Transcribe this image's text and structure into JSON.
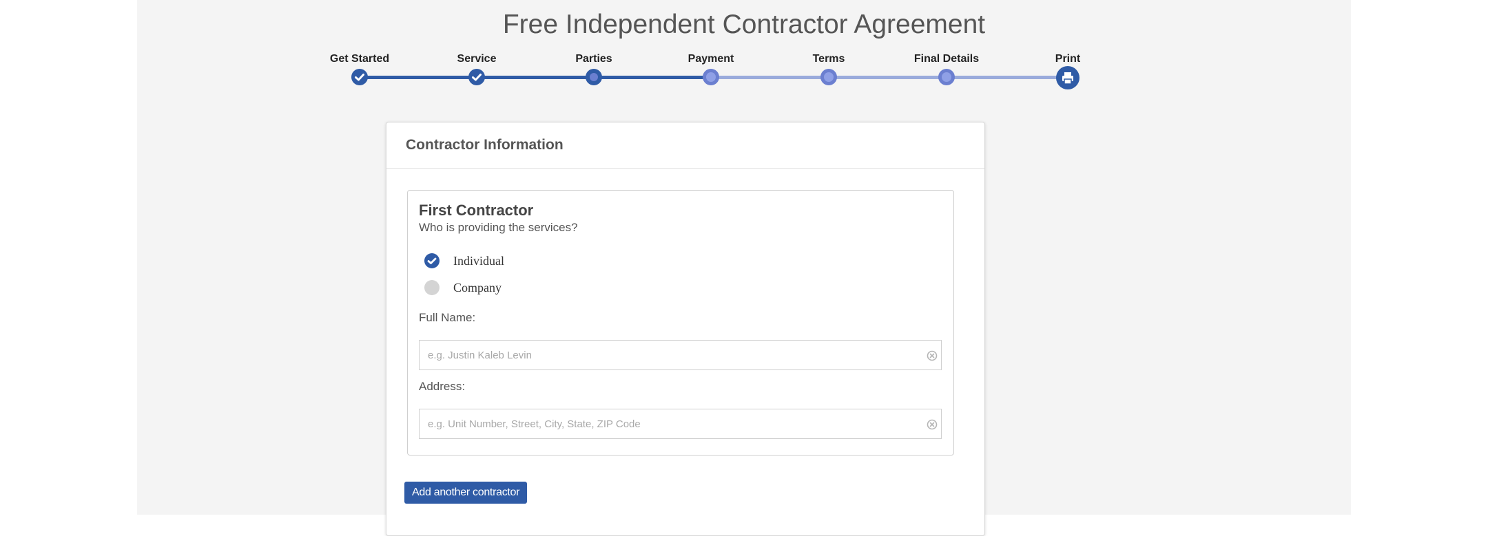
{
  "page": {
    "title": "Free Independent Contractor Agreement"
  },
  "stepper": {
    "steps": [
      {
        "label": "Get Started",
        "state": "done",
        "icon": "check-icon"
      },
      {
        "label": "Service",
        "state": "done",
        "icon": "check-icon"
      },
      {
        "label": "Parties",
        "state": "current",
        "icon": "dot-icon"
      },
      {
        "label": "Payment",
        "state": "todo",
        "icon": "dot-icon"
      },
      {
        "label": "Terms",
        "state": "todo",
        "icon": "dot-icon"
      },
      {
        "label": "Final Details",
        "state": "todo",
        "icon": "dot-icon"
      },
      {
        "label": "Print",
        "state": "todo",
        "icon": "printer-icon"
      }
    ]
  },
  "card": {
    "title": "Contractor Information",
    "section": {
      "title": "First Contractor",
      "subtitle": "Who is providing the services?",
      "options": [
        {
          "label": "Individual",
          "checked": true
        },
        {
          "label": "Company",
          "checked": false
        }
      ],
      "full_name": {
        "label": "Full Name:",
        "value": "",
        "placeholder": "e.g. Justin Kaleb Levin"
      },
      "address": {
        "label": "Address:",
        "value": "",
        "placeholder": "e.g. Unit Number, Street, City, State, ZIP Code"
      }
    },
    "add_button_label": "Add another contractor"
  },
  "colors": {
    "accent": "#2f5ba6",
    "step_pending": "#8fa0e6",
    "page_background": "#f4f4f4"
  }
}
